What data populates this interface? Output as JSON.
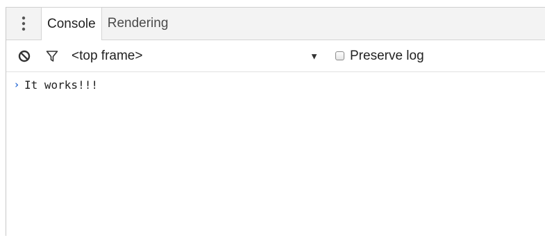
{
  "tabs": [
    {
      "label": "Console",
      "active": true
    },
    {
      "label": "Rendering",
      "active": false
    }
  ],
  "toolbar": {
    "clear_icon": "block-icon",
    "filter_icon": "funnel-icon",
    "context_value": "<top frame>",
    "dropdown_arrow": "▼",
    "preserve_log_label": "Preserve log",
    "preserve_log_checked": false
  },
  "console": {
    "lines": [
      {
        "prompt": "›",
        "text": "It works!!!"
      }
    ]
  },
  "colors": {
    "tabbar_bg": "#f3f3f3",
    "prompt": "#2f6fd6"
  }
}
